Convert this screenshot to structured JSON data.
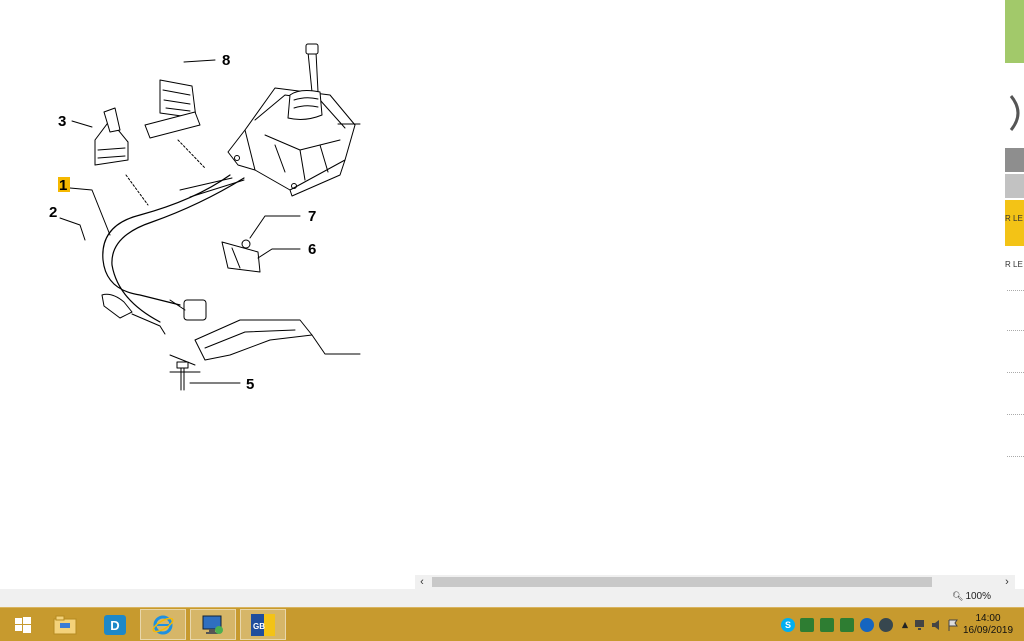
{
  "diagram": {
    "callouts": [
      "8",
      "3",
      "1",
      "2",
      "7",
      "6",
      "5"
    ]
  },
  "side_panel": {
    "labels": [
      "R LE",
      "R LE"
    ],
    "colors": {
      "green": "#a2c96a",
      "gray": "#8e8e8e",
      "yellow": "#f3c316"
    }
  },
  "status": {
    "zoom": "100%"
  },
  "taskbar": {
    "items": [
      "start-icon",
      "file-explorer-icon",
      "dcp-app-icon",
      "internet-explorer-icon",
      "remote-desktop-icon",
      "eper-app-icon"
    ],
    "eper_label": "GB",
    "tray_skype": "S",
    "colors": {
      "taskbar": "#c79a2e",
      "highlight": "#f5b800"
    }
  },
  "clock": {
    "time": "14:00",
    "date": "16/09/2019"
  }
}
